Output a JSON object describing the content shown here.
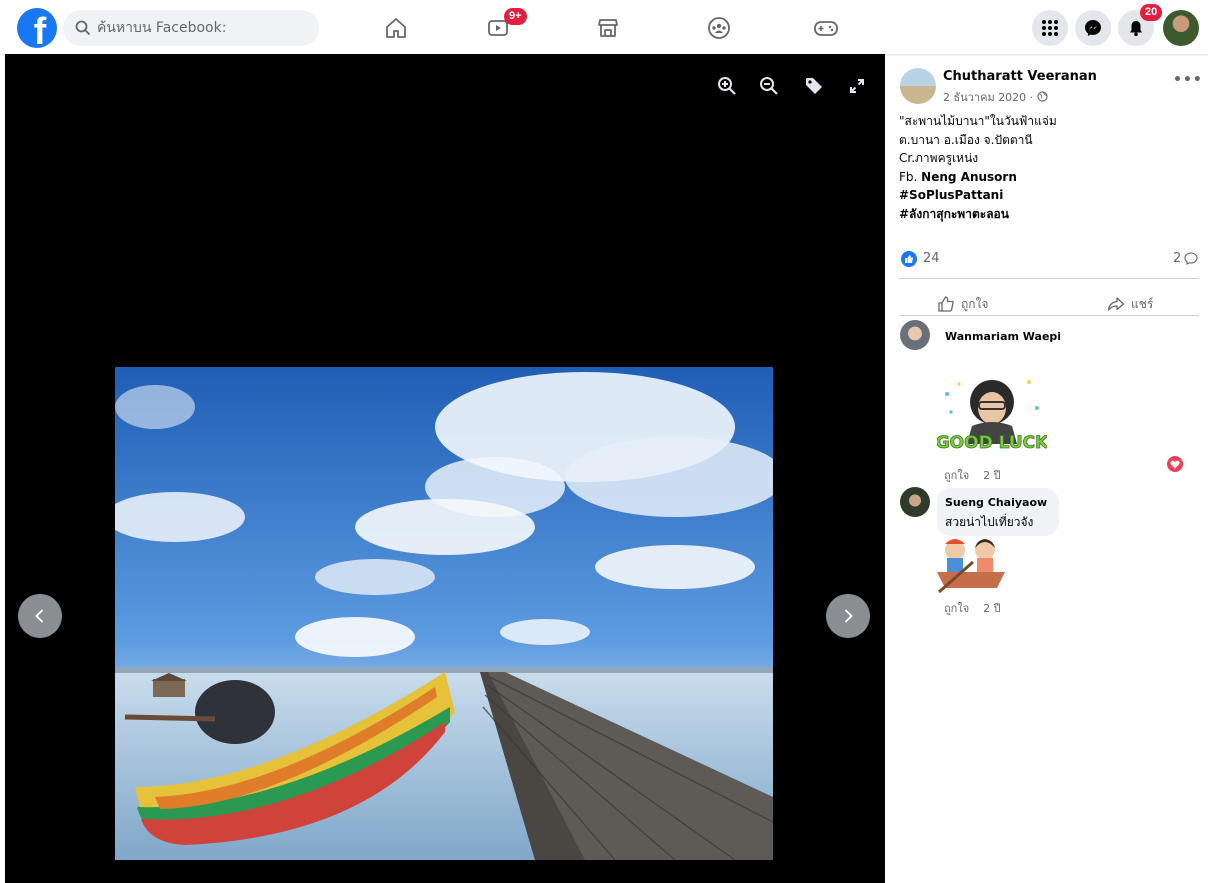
{
  "search": {
    "placeholder": "ค้นหาบน Facebook:"
  },
  "nav": {
    "watch_badge": "9+",
    "notifications_badge": "20"
  },
  "post": {
    "author": "Chutharatt Veeranan",
    "date": "2 ธันวาคม 2020 ·",
    "lines": [
      "\"สะพานไม้บานา\"ในวันฟ้าแจ่ม",
      "ต.บานา อ.เมือง จ.ปัตตานี",
      "Cr.ภาพครูเหน่ง"
    ],
    "fb_prefix": "Fb.",
    "fb_name": "Neng Anusorn",
    "hashtag1": "#SoPlusPattani",
    "hashtag2": "#ลังกาสุกะพาตะลอน",
    "reactions_count": "24",
    "comments_count": "2",
    "like_label": "ถูกใจ",
    "share_label": "แชร์"
  },
  "comments": [
    {
      "name": "Wanmariam Waepi",
      "sticker_text": "GOOD LUCK",
      "like_label": "ถูกใจ",
      "age": "2 ปี"
    },
    {
      "name": "Sueng Chaiyaow",
      "text": "สวยน่าไปเที่ยวจัง",
      "like_label": "ถูกใจ",
      "age": "2 ปี"
    }
  ],
  "colors": {
    "brand": "#1877f2",
    "badge": "#e41e3f",
    "love": "#f33e58"
  }
}
